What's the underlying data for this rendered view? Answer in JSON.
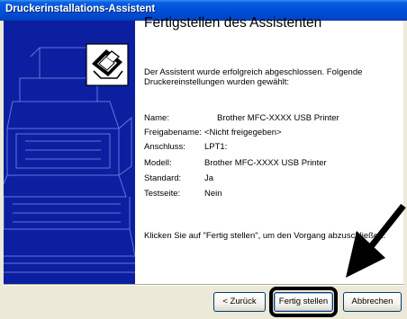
{
  "window": {
    "title": "Druckerinstallations-Assistent"
  },
  "main": {
    "heading": "Fertigstellen des Assistenten",
    "intro_line1": "Der Assistent wurde erfolgreich abgeschlossen. Folgende",
    "intro_line2": "Druckereinstellungen wurden gewählt:",
    "settings": [
      {
        "label": "Name:",
        "value": "Brother MFC-XXXX USB Printer"
      },
      {
        "label": "Freigabename:",
        "value": "<Nicht freigegeben>"
      },
      {
        "label": "Anschluss:",
        "value": "LPT1:"
      },
      {
        "label": "Modell:",
        "value": "Brother MFC-XXXX USB Printer"
      },
      {
        "label": "Standard:",
        "value": "Ja"
      },
      {
        "label": "Testseite:",
        "value": "Nein"
      }
    ],
    "footer_text": "Klicken Sie auf \"Fertig stellen\", um den Vorgang abzuschließen."
  },
  "buttons": {
    "back_label": "< Zurück",
    "finish_label": "Fertig stellen",
    "cancel_label": "Abbrechen"
  },
  "icons": {
    "wizard_logo": "printer-logo-icon",
    "pointer": "arrow-pointer-icon"
  },
  "colors": {
    "side_panel": "#0b1fa0",
    "titlebar": "#0050d8"
  }
}
